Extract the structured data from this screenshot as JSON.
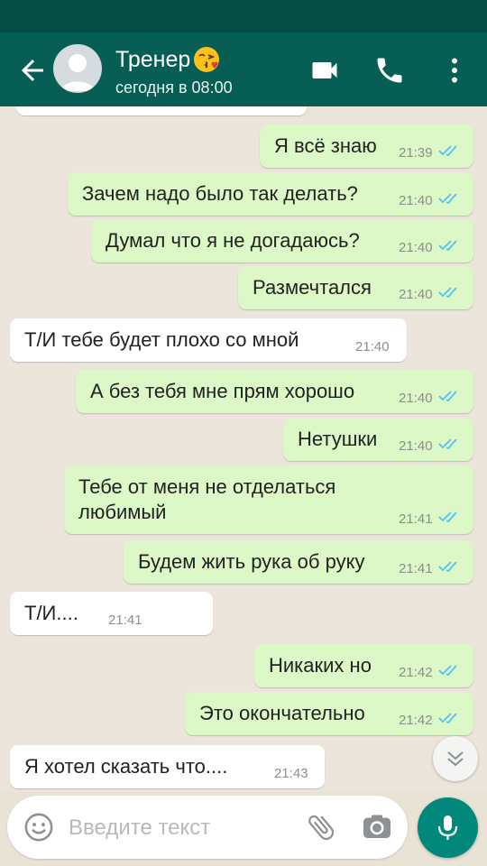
{
  "header": {
    "contact_name": "Тренер",
    "contact_emoji": "kissing-face-emoji",
    "contact_status": "сегодня в 08:00",
    "icons": [
      "back-arrow-icon",
      "avatar-placeholder",
      "video-call-icon",
      "phone-call-icon",
      "more-vert-icon"
    ]
  },
  "colors": {
    "header_bg": "#075e54",
    "status_bar": "#054d44",
    "outgoing_bubble": "#dcf8c6",
    "incoming_bubble": "#ffffff",
    "read_ticks": "#4fc3f7",
    "mic_button": "#00897b"
  },
  "messages": [
    {
      "direction": "out",
      "text": "Я всё знаю",
      "time": "21:39",
      "read": true
    },
    {
      "direction": "out",
      "text": "Зачем надо было так делать?",
      "time": "21:40",
      "read": true
    },
    {
      "direction": "out",
      "text": "Думал что я не догадаюсь?",
      "time": "21:40",
      "read": true
    },
    {
      "direction": "out",
      "text": "Размечтался",
      "time": "21:40",
      "read": true
    },
    {
      "direction": "in",
      "text": "Т/И тебе будет плохо со мной",
      "time": "21:40"
    },
    {
      "direction": "out",
      "text": "А без тебя мне прям хорошо",
      "time": "21:40",
      "read": true
    },
    {
      "direction": "out",
      "text": "Нетушки",
      "time": "21:40",
      "read": true
    },
    {
      "direction": "out",
      "text": "Тебе от меня не отделаться\nлюбимый",
      "time": "21:41",
      "read": true
    },
    {
      "direction": "out",
      "text": "Будем жить рука об руку",
      "time": "21:41",
      "read": true
    },
    {
      "direction": "in",
      "text": "Т/И....",
      "time": "21:41"
    },
    {
      "direction": "out",
      "text": "Никаких но",
      "time": "21:42",
      "read": true
    },
    {
      "direction": "out",
      "text": "Это окончательно",
      "time": "21:42",
      "read": true
    },
    {
      "direction": "in",
      "text": "Я хотел сказать что....",
      "time": "21:43"
    }
  ],
  "input": {
    "placeholder": "Введите текст",
    "value": "",
    "icons": [
      "emoji-icon",
      "attach-icon",
      "camera-icon",
      "mic-icon"
    ]
  },
  "scroll_down_icon": "double-chevron-down-icon"
}
